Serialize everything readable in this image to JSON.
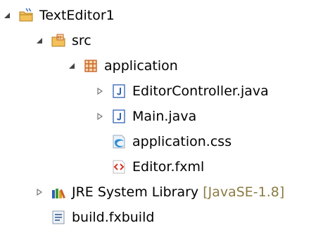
{
  "tree": {
    "items": [
      {
        "label": "TextEditor1",
        "icon": "java-project-icon",
        "twisty": "expanded"
      },
      {
        "label": "src",
        "icon": "source-folder-icon",
        "twisty": "expanded"
      },
      {
        "label": "application",
        "icon": "package-icon",
        "twisty": "expanded"
      },
      {
        "label": "EditorController.java",
        "icon": "java-file-icon",
        "twisty": "collapsed"
      },
      {
        "label": "Main.java",
        "icon": "java-file-icon",
        "twisty": "collapsed"
      },
      {
        "label": "application.css",
        "icon": "css-file-icon",
        "twisty": "none"
      },
      {
        "label": "Editor.fxml",
        "icon": "fxml-file-icon",
        "twisty": "none"
      },
      {
        "label": "JRE System Library",
        "decoration": "[JavaSE-1.8]",
        "icon": "library-icon",
        "twisty": "collapsed"
      },
      {
        "label": "build.fxbuild",
        "icon": "fxbuild-file-icon",
        "twisty": "none"
      }
    ]
  },
  "colors": {
    "decoration": "#8b7b44",
    "java_icon": "#2f62b3",
    "folder": "#e8b54a",
    "package": "#c9632d"
  }
}
